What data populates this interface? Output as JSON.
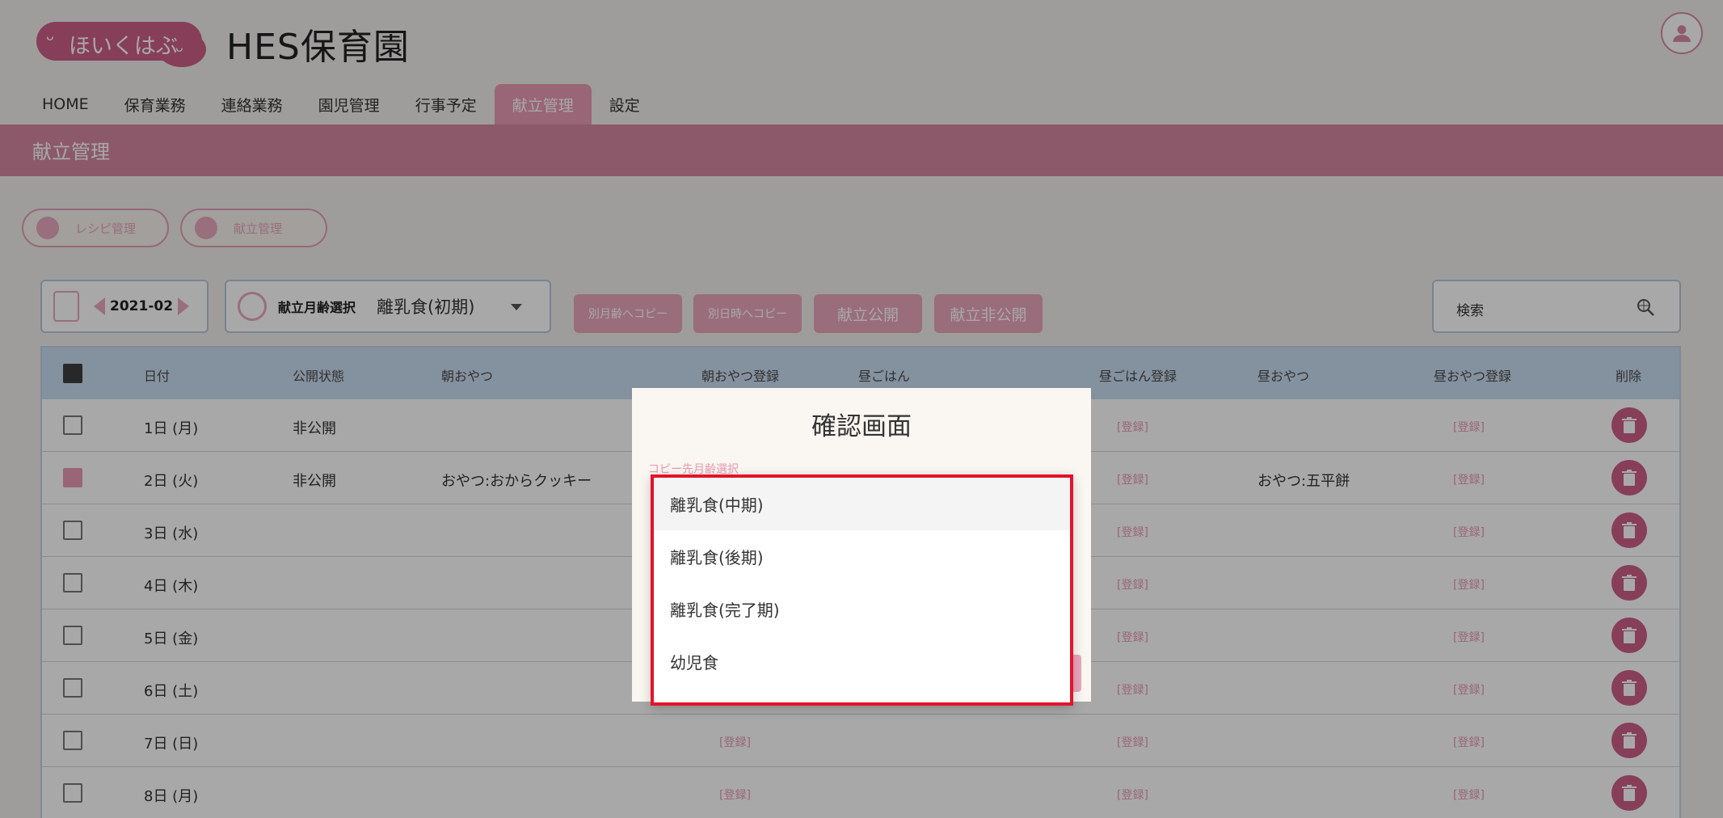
{
  "brand": {
    "logo_text": "ほいくはぶ",
    "title": "HES保育園"
  },
  "nav": [
    "HOME",
    "保育業務",
    "連絡業務",
    "園児管理",
    "行事予定",
    "献立管理",
    "設定"
  ],
  "section_title": "献立管理",
  "sub_buttons": {
    "recipe": "レシピ管理",
    "menu": "献立管理"
  },
  "toolbar": {
    "month": "2021-02",
    "age_label": "献立月齢選択",
    "age_value": "離乳食(初期)",
    "copy_other_age": "別月齢へコピー",
    "copy_other_date": "別日時へコピー",
    "publish": "献立公開",
    "unpublish": "献立非公開",
    "search_placeholder": "検索"
  },
  "table": {
    "headers": [
      "日付",
      "公開状態",
      "朝おやつ",
      "朝おやつ登録",
      "昼ごはん",
      "昼ごはん登録",
      "昼おやつ",
      "昼おやつ登録",
      "削除"
    ],
    "register_label": "[登録]",
    "rows": [
      {
        "date": "1日 (月)",
        "status": "非公開",
        "morning": "",
        "lunch": "",
        "afternoon": ""
      },
      {
        "date": "2日 (火)",
        "status": "非公開",
        "morning": "おやつ:おからクッキー",
        "lunch": "",
        "afternoon": "おやつ:五平餅"
      },
      {
        "date": "3日 (水)",
        "status": "",
        "morning": "",
        "lunch": "",
        "afternoon": ""
      },
      {
        "date": "4日 (木)",
        "status": "",
        "morning": "",
        "lunch": "",
        "afternoon": ""
      },
      {
        "date": "5日 (金)",
        "status": "",
        "morning": "",
        "lunch": "",
        "afternoon": ""
      },
      {
        "date": "6日 (土)",
        "status": "",
        "morning": "",
        "lunch": "",
        "afternoon": ""
      },
      {
        "date": "7日 (日)",
        "status": "",
        "morning": "",
        "lunch": "",
        "afternoon": ""
      },
      {
        "date": "8日 (月)",
        "status": "",
        "morning": "",
        "lunch": "",
        "afternoon": ""
      }
    ]
  },
  "modal": {
    "title": "確認画面",
    "field_label": "コピー先月齢選択",
    "options": [
      "離乳食(中期)",
      "離乳食(後期)",
      "離乳食(完了期)",
      "幼児食"
    ]
  }
}
